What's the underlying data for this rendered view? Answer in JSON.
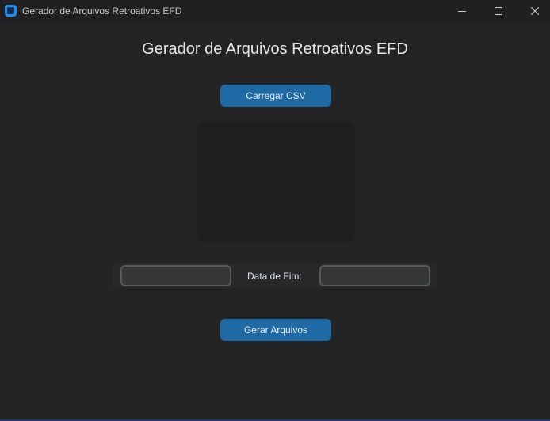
{
  "window": {
    "title": "Gerador de Arquivos Retroativos EFD",
    "app_icon": "app-icon"
  },
  "window_controls": {
    "minimize": "minimize-icon",
    "maximize": "maximize-icon",
    "close": "close-icon"
  },
  "main": {
    "heading": "Gerador de Arquivos Retroativos EFD",
    "load_button_label": "Carregar CSV",
    "generate_button_label": "Gerar Arquivos",
    "date": {
      "start_value": "",
      "end_label": "Data de Fim:",
      "end_value": ""
    }
  },
  "colors": {
    "background": "#242424",
    "button": "#1f6aa5",
    "entry": "#343638",
    "entry_border": "#565b5e"
  }
}
